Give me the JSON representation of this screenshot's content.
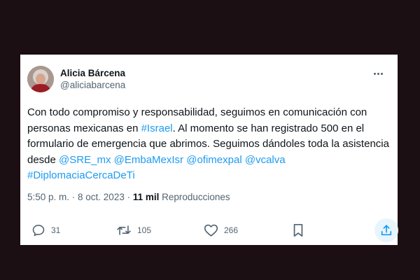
{
  "tweet": {
    "author_name": "Alicia Bárcena",
    "author_handle": "@aliciabarcena",
    "body": [
      {
        "text": "Con todo compromiso y responsabilidad, seguimos en comunicación con personas mexicanas en ",
        "link": false
      },
      {
        "text": "#Israel",
        "link": true
      },
      {
        "text": ". Al momento se han registrado 500 en el formulario de emergencia que abrimos. Seguimos dándoles toda la asistencia desde ",
        "link": false
      },
      {
        "text": "@SRE_mx",
        "link": true
      },
      {
        "text": " ",
        "link": false
      },
      {
        "text": "@EmbaMexIsr",
        "link": true
      },
      {
        "text": " ",
        "link": false
      },
      {
        "text": "@ofimexpal",
        "link": true
      },
      {
        "text": " ",
        "link": false
      },
      {
        "text": "@vcalva",
        "link": true
      },
      {
        "text": " ",
        "link": false
      },
      {
        "text": "#DiplomaciaCercaDeTi",
        "link": true
      }
    ],
    "timestamp": "5:50 p. m. · 8 oct. 2023 · ",
    "views_count": "11 mil",
    "views_label": " Reproducciones"
  },
  "actions": {
    "reply_count": "31",
    "retweet_count": "105",
    "like_count": "266"
  },
  "icons": {
    "more": "more-horizontal-icon",
    "reply": "speech-bubble-icon",
    "retweet": "retweet-arrows-icon",
    "like": "heart-icon",
    "bookmark": "bookmark-icon",
    "share": "share-upload-icon"
  },
  "colors": {
    "background": "#1c0f14",
    "card": "#ffffff",
    "link": "#1d9bf0",
    "text": "#0f1419",
    "muted": "#536471"
  }
}
